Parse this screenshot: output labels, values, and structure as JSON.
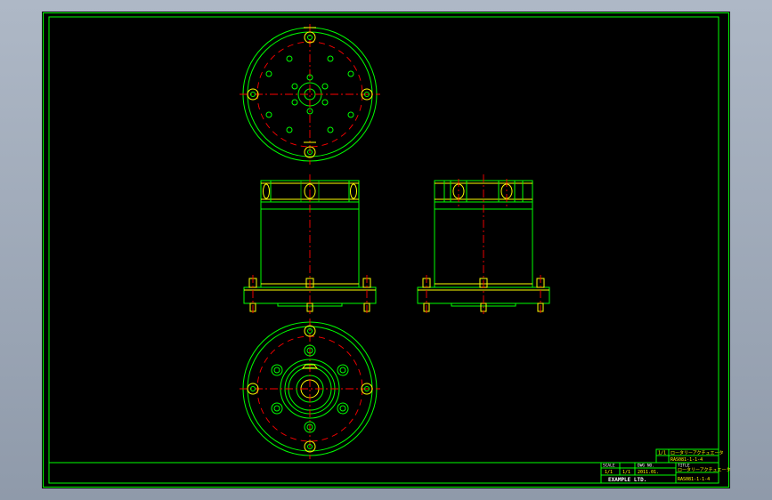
{
  "colors": {
    "background": "#000000",
    "outline": "#00ff00",
    "centerline": "#ff0000",
    "text": "#ffff00",
    "label": "#ffffff"
  },
  "title_block": {
    "scale_header": "SCALE",
    "scale": "1/1",
    "title_header": "TITLE",
    "title": "ロータリーアクチュエータ",
    "drawing_header": "DWG NO.",
    "drawing_number": "RAS081-1-1-4",
    "sheet": "1/1",
    "date": "2011.01.",
    "company": "EXAMPLE LTD."
  }
}
